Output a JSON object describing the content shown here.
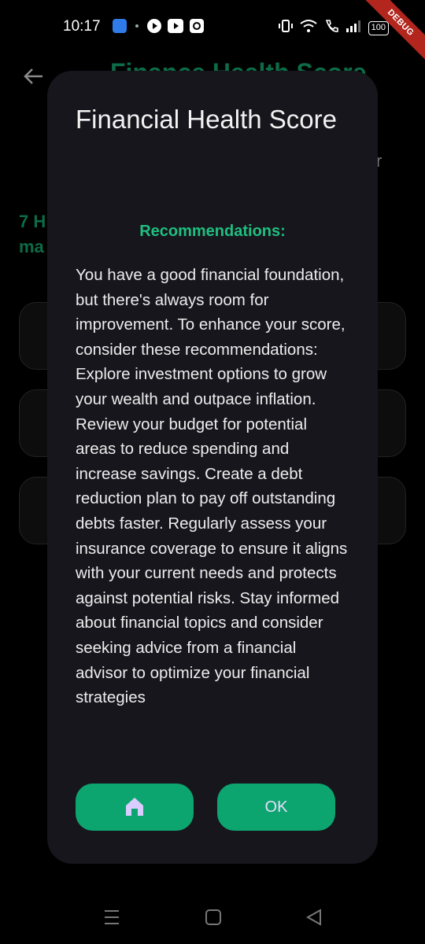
{
  "status_bar": {
    "time": "10:17",
    "battery": "100",
    "debug_label": "DEBUG"
  },
  "background_page": {
    "title": "Finance Health Score",
    "partial_right_text": "r",
    "green_text_line1": "7 H",
    "green_text_line2": "ma"
  },
  "dialog": {
    "title": "Financial Health Score",
    "recommendations_heading": "Recommendations:",
    "recommendations_text": "You have a good financial foundation, but there's always room for improvement. To enhance your score, consider these recommendations: Explore investment options to grow your wealth and outpace inflation. Review your budget for potential areas to reduce spending and increase savings. Create a debt reduction plan to pay off outstanding debts faster. Regularly assess your insurance coverage to ensure it aligns with your current needs and protects against potential risks. Stay informed about financial topics and consider seeking advice from a financial advisor to optimize your financial strategies",
    "home_button_icon": "home-icon",
    "ok_label": "OK"
  },
  "colors": {
    "accent_green": "#0da56f",
    "heading_green": "#1fbf7f",
    "dialog_bg": "#17161d",
    "button_text": "#e6dcff"
  }
}
